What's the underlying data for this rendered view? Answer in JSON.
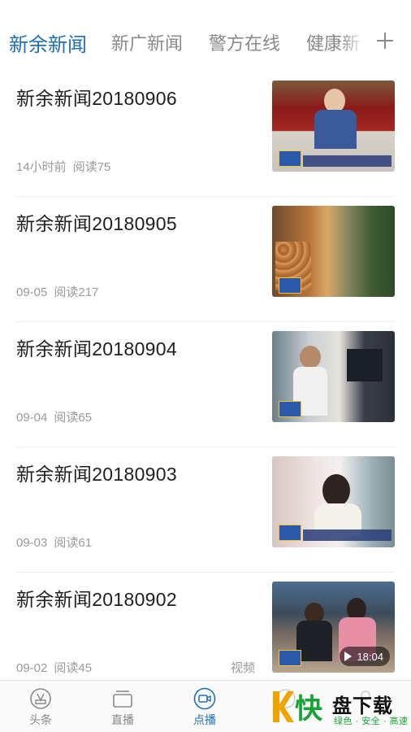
{
  "tabs": [
    {
      "label": "新余新闻",
      "active": true
    },
    {
      "label": "新广新闻",
      "active": false
    },
    {
      "label": "警方在线",
      "active": false
    },
    {
      "label": "健康新",
      "active": false
    }
  ],
  "tab_add_icon": "plus-icon",
  "news": [
    {
      "title": "新余新闻20180906",
      "time": "14小时前",
      "reads": "阅读75",
      "tag": ""
    },
    {
      "title": "新余新闻20180905",
      "time": "09-05",
      "reads": "阅读217",
      "tag": ""
    },
    {
      "title": "新余新闻20180904",
      "time": "09-04",
      "reads": "阅读65",
      "tag": ""
    },
    {
      "title": "新余新闻20180903",
      "time": "09-03",
      "reads": "阅读61",
      "tag": ""
    },
    {
      "title": "新余新闻20180902",
      "time": "09-02",
      "reads": "阅读45",
      "tag": "视频",
      "duration": "18:04"
    }
  ],
  "bottom_nav": [
    {
      "label": "头条",
      "icon": "headline-icon",
      "active": false
    },
    {
      "label": "直播",
      "icon": "live-tv-icon",
      "active": false
    },
    {
      "label": "点播",
      "icon": "video-camera-icon",
      "active": true
    },
    {
      "label": "",
      "icon": "discover-icon",
      "active": false
    },
    {
      "label": "",
      "icon": "profile-icon",
      "active": false
    }
  ],
  "watermark": {
    "brand": "快",
    "name": "盘下载",
    "slogan": "绿色 · 安全 · 高速"
  },
  "colors": {
    "accent": "#1e6fb4",
    "muted": "#8a8a8a",
    "watermark_green": "#16a336"
  }
}
